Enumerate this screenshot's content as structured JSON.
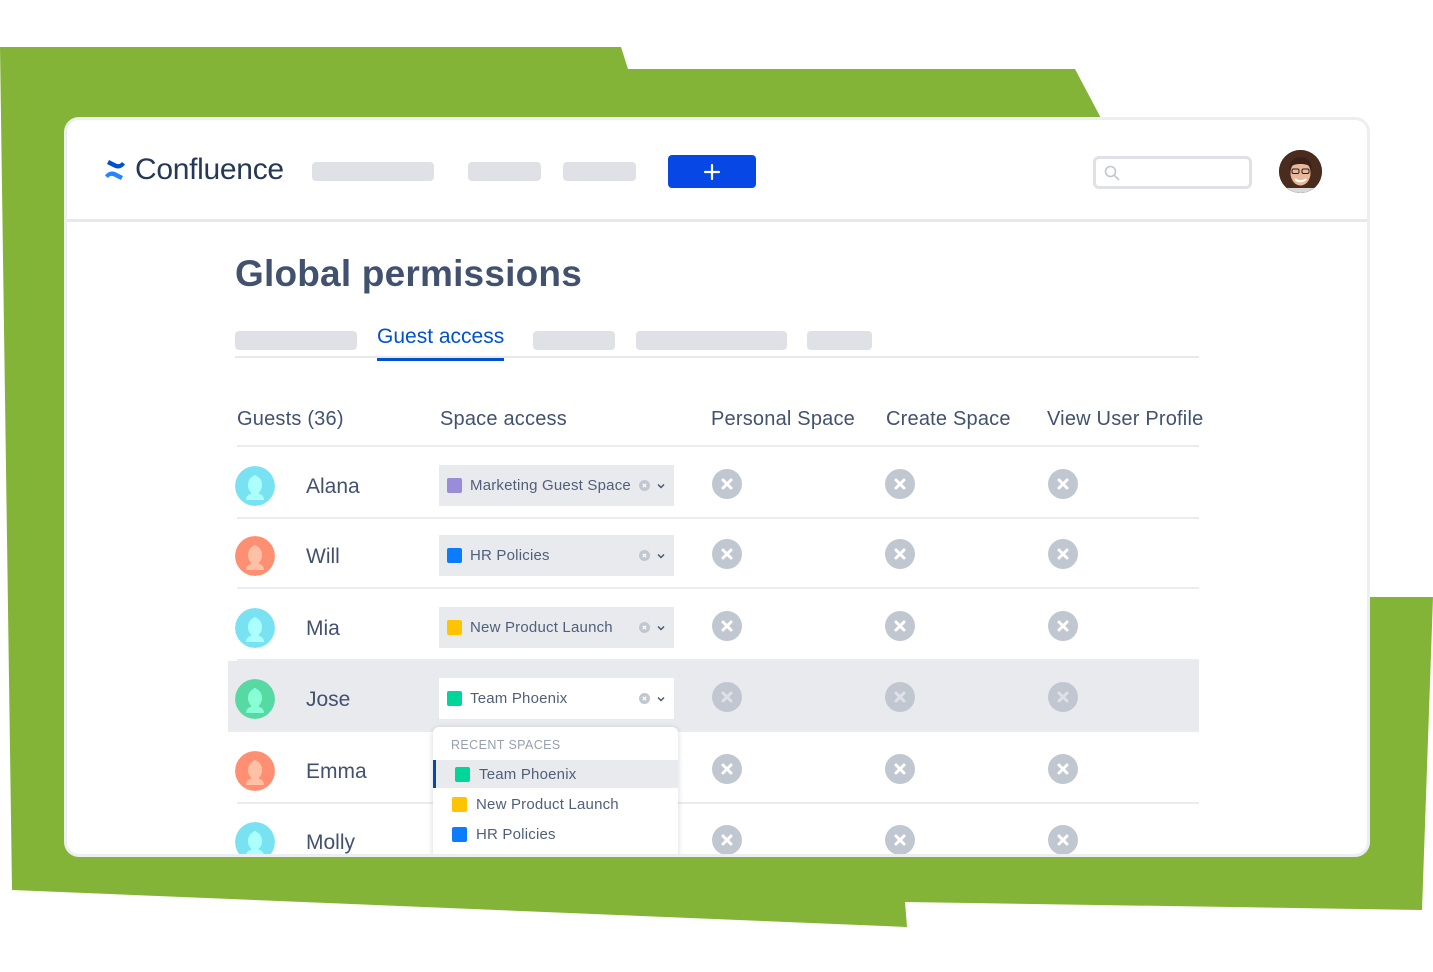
{
  "colors": {
    "background_accent": "#84b437",
    "brand_blue": "#0747e6",
    "link_blue": "#0052cc",
    "text": "#42526e",
    "placeholder_gray": "#dfe1e6",
    "disabled_icon": "#c1c7d0"
  },
  "app": {
    "name": "Confluence",
    "logo_icon": "confluence-logo-icon"
  },
  "topnav": {
    "create_button_icon": "plus-icon",
    "search": {
      "value": "",
      "placeholder": "",
      "icon": "search-icon"
    },
    "profile_avatar_icon": "user-photo-avatar"
  },
  "page": {
    "title": "Global permissions",
    "tabs": [
      {
        "label": "",
        "placeholder": true
      },
      {
        "label": "Guest access",
        "active": true
      },
      {
        "label": "",
        "placeholder": true
      },
      {
        "label": "",
        "placeholder": true
      },
      {
        "label": "",
        "placeholder": true
      }
    ]
  },
  "table": {
    "columns": [
      "Guests (36)",
      "Space access",
      "Personal Space",
      "Create Space",
      "View User Profile"
    ],
    "rows": [
      {
        "name": "Alana",
        "avatar_color": "#79e2f2",
        "space": "Marketing Guest Space",
        "space_color": "#998dd9",
        "personal_space": false,
        "create_space": false,
        "view_user_profile": false
      },
      {
        "name": "Will",
        "avatar_color": "#ff8f73",
        "space": "HR Policies",
        "space_color": "#0c7cff",
        "personal_space": false,
        "create_space": false,
        "view_user_profile": false
      },
      {
        "name": "Mia",
        "avatar_color": "#79e2f2",
        "space": "New Product Launch",
        "space_color": "#ffc400",
        "personal_space": false,
        "create_space": false,
        "view_user_profile": false
      },
      {
        "name": "Jose",
        "avatar_color": "#57d9a3",
        "space": "Team Phoenix",
        "space_color": "#00d69a",
        "personal_space": false,
        "create_space": false,
        "view_user_profile": false,
        "highlighted": true
      },
      {
        "name": "Emma",
        "avatar_color": "#ff8f73",
        "space": "",
        "space_color": "",
        "personal_space": false,
        "create_space": false,
        "view_user_profile": false
      },
      {
        "name": "Molly",
        "avatar_color": "#79e2f2",
        "space": "",
        "space_color": "",
        "personal_space": false,
        "create_space": false,
        "view_user_profile": false
      }
    ]
  },
  "dropdown": {
    "heading": "RECENT SPACES",
    "items": [
      {
        "label": "Team Phoenix",
        "color": "#00d69a",
        "selected": true
      },
      {
        "label": "New Product Launch",
        "color": "#ffc400",
        "selected": false
      },
      {
        "label": "HR Policies",
        "color": "#0c7cff",
        "selected": false
      }
    ]
  }
}
